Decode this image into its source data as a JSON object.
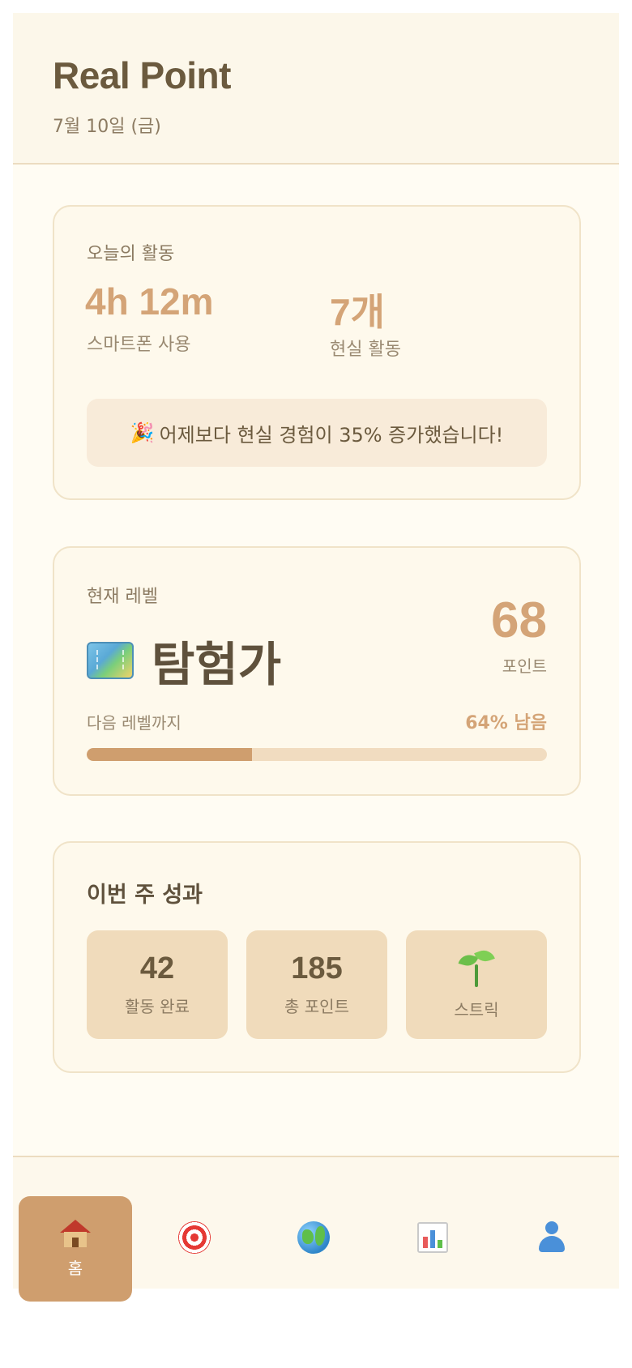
{
  "header": {
    "title": "Real Point",
    "date": "7월 10일 (금)"
  },
  "today": {
    "label": "오늘의 활동",
    "screen_time": {
      "value": "4h 12m",
      "label": "스마트폰 사용"
    },
    "activities": {
      "value": "7개",
      "label": "현실 활동"
    },
    "banner_emoji": "🎉",
    "banner_text": "어제보다 현실 경험이 35% 증가했습니다!"
  },
  "level": {
    "label": "현재 레벨",
    "name": "탐험가",
    "icon": "map-icon",
    "points": "68",
    "points_label": "포인트",
    "next_label": "다음 레벨까지",
    "remaining": "64% 남음",
    "progress_fraction": 0.36
  },
  "week": {
    "title": "이번 주 성과",
    "stats": [
      {
        "value": "42",
        "label": "활동 완료"
      },
      {
        "value": "185",
        "label": "총 포인트"
      },
      {
        "icon": "sprout-icon",
        "label": "스트릭"
      }
    ]
  },
  "nav": {
    "items": [
      {
        "icon": "home-icon",
        "label": "홈",
        "active": true
      },
      {
        "icon": "target-icon",
        "label": ""
      },
      {
        "icon": "globe-icon",
        "label": ""
      },
      {
        "icon": "chart-icon",
        "label": ""
      },
      {
        "icon": "user-icon",
        "label": ""
      }
    ]
  },
  "colors": {
    "accent": "#cf9e6e",
    "accent_text": "#d4a477",
    "background": "#fffcf3",
    "card": "#fef9ec",
    "stat_box": "#f0dbbb"
  }
}
